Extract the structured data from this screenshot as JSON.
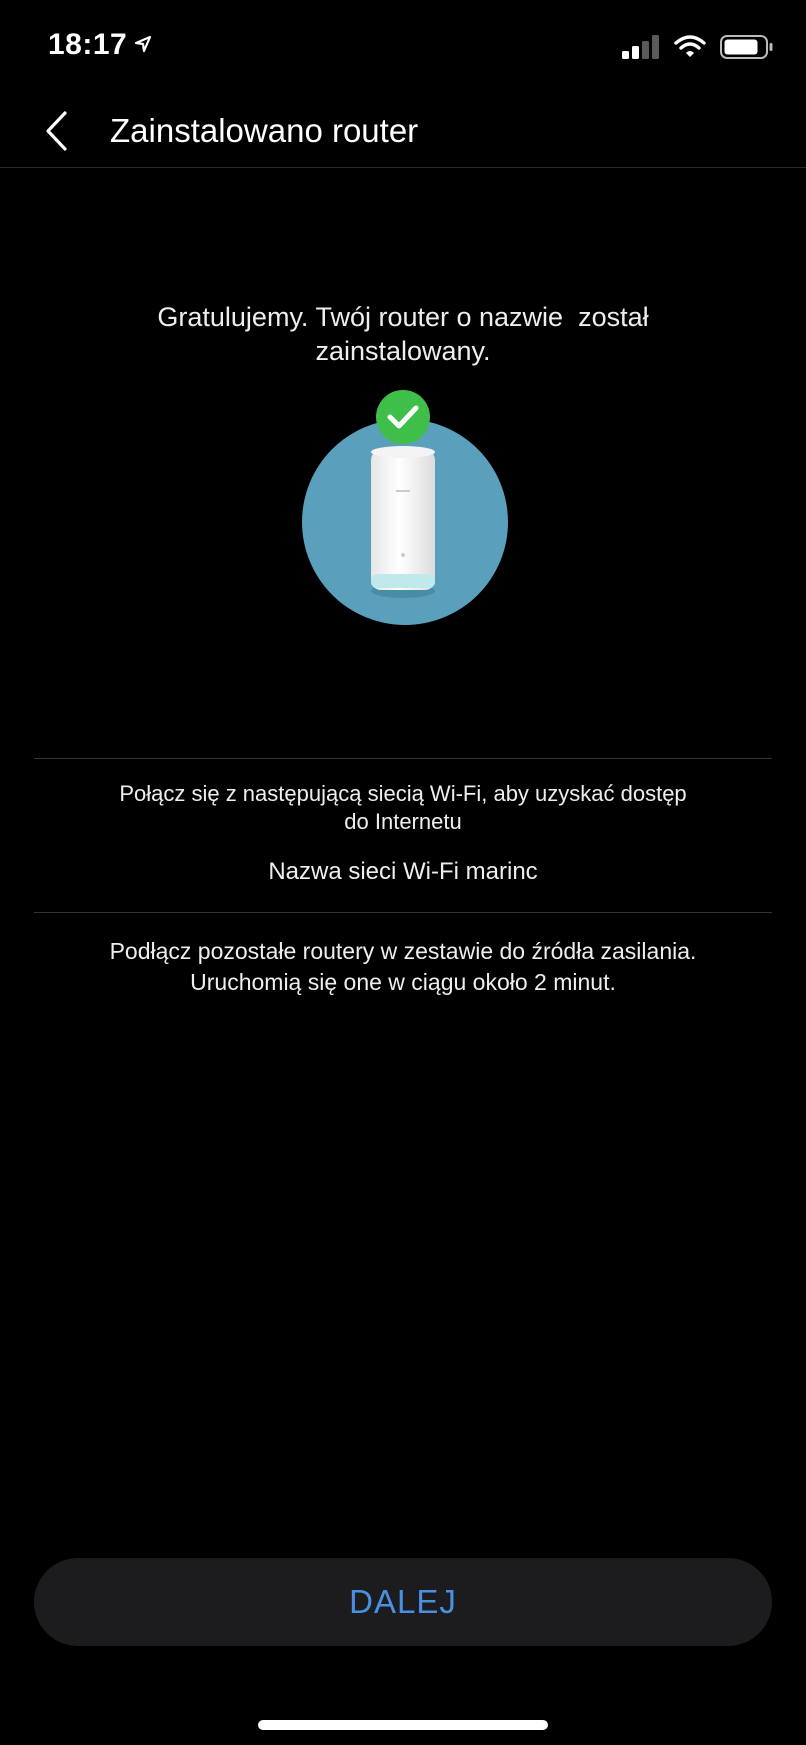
{
  "status_bar": {
    "time": "18:17",
    "location_icon": "location-arrow-icon",
    "signal_icon": "cellular-signal-icon",
    "wifi_icon": "wifi-icon",
    "battery_icon": "battery-icon"
  },
  "nav": {
    "back_icon": "chevron-left-icon",
    "title": "Zainstalowano router"
  },
  "congrats": {
    "line1": "Gratulujemy. Twój router o nazwie  został",
    "line2": "zainstalowany."
  },
  "illustration": {
    "check_icon": "checkmark-icon",
    "circle_color": "#5aa0bd",
    "badge_color": "#3fbf4a"
  },
  "wifi_section": {
    "instruction_line1": "Połącz się z następującą siecią Wi-Fi, aby uzyskać dostęp",
    "instruction_line2": "do Internetu",
    "network_name": "Nazwa sieci Wi-Fi marinc"
  },
  "power_section": {
    "line1": "Podłącz pozostałe routery w zestawie do źródła zasilania.",
    "line2": "Uruchomią się one w ciągu około 2 minut."
  },
  "buttons": {
    "next_label": "DALEJ"
  },
  "colors": {
    "background": "#000000",
    "accent": "#4a90e2",
    "button_bg": "#1c1c1e"
  }
}
